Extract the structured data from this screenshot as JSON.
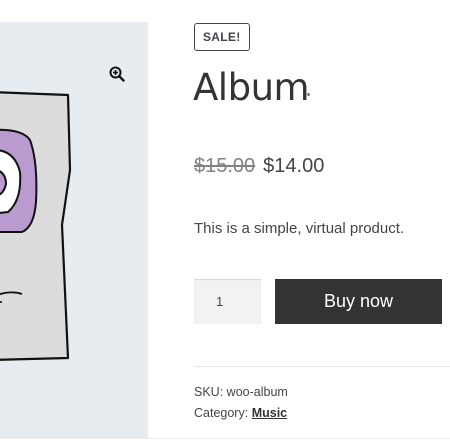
{
  "gallery": {
    "zoom_icon": "magnifier-plus-icon"
  },
  "product": {
    "sale_badge": "SALE!",
    "title": "Album",
    "price_old": "$15.00",
    "price_new": "$14.00",
    "description": "This is a simple, virtual product."
  },
  "cart": {
    "quantity": "1",
    "buy_label": "Buy now"
  },
  "meta": {
    "sku_label": "SKU:",
    "sku_value": "woo-album",
    "category_label": "Category:",
    "category_value": "Music"
  },
  "colors": {
    "accent_dark": "#333333",
    "text": "#43454b",
    "gallery_bg": "#e6ecf0",
    "art_purple": "#b99bcf"
  }
}
